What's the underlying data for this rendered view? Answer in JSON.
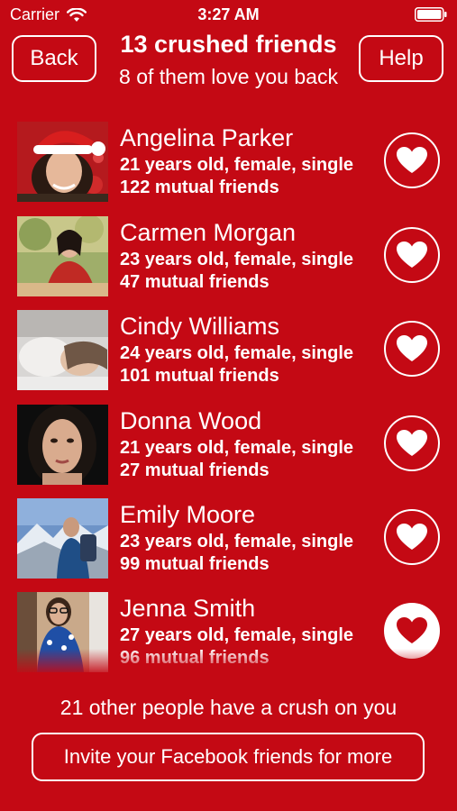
{
  "status_bar": {
    "carrier": "Carrier",
    "time": "3:27 AM"
  },
  "nav": {
    "back_label": "Back",
    "title": "13 crushed friends",
    "subtitle": "8 of them love you back",
    "help_label": "Help"
  },
  "friends": [
    {
      "name": "Angelina Parker",
      "details": "21 years old, female, single",
      "mutual": "122 mutual friends",
      "liked": false
    },
    {
      "name": "Carmen Morgan",
      "details": "23 years old, female, single",
      "mutual": "47 mutual friends",
      "liked": false
    },
    {
      "name": "Cindy Williams",
      "details": "24 years old, female, single",
      "mutual": "101 mutual friends",
      "liked": false
    },
    {
      "name": "Donna Wood",
      "details": "21 years old, female, single",
      "mutual": "27 mutual friends",
      "liked": false
    },
    {
      "name": "Emily Moore",
      "details": "23 years old, female, single",
      "mutual": "99 mutual friends",
      "liked": false
    },
    {
      "name": "Jenna Smith",
      "details": "27 years old, female, single",
      "mutual": "96 mutual friends",
      "liked": true
    }
  ],
  "footer": {
    "crush_count_text": "21 other people have a crush on you",
    "invite_label": "Invite your Facebook friends for more"
  },
  "colors": {
    "background": "#c40914",
    "foreground": "#ffffff"
  }
}
